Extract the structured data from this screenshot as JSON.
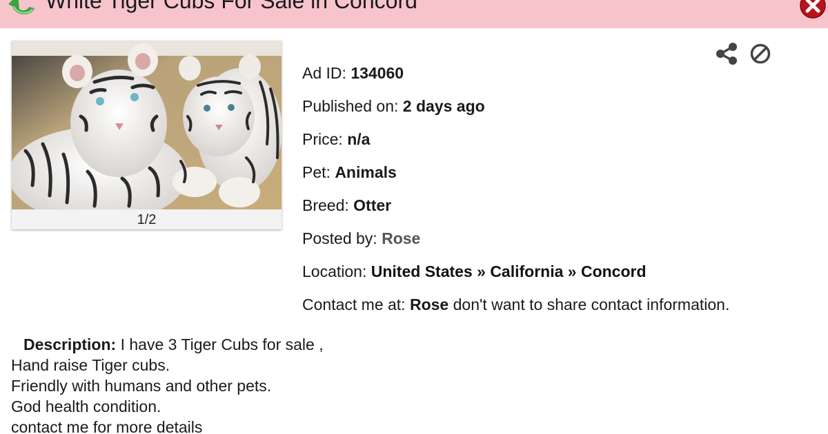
{
  "header": {
    "title": "White Tiger Cubs For Sale in Concord",
    "background_color": "#f8c4cc",
    "back_icon": "back-arrow-icon",
    "close_icon": "close-icon"
  },
  "gallery": {
    "counter": "1/2",
    "image_description_icon": "tiger-cubs-photo"
  },
  "actions": {
    "share_icon": "share-icon",
    "block_icon": "block-icon"
  },
  "details": {
    "ad_id_label": "Ad ID:",
    "ad_id_value": "134060",
    "published_label": "Published on:",
    "published_value": "2 days ago",
    "price_label": "Price:",
    "price_value": "n/a",
    "pet_label": "Pet:",
    "pet_value": "Animals",
    "breed_label": "Breed:",
    "breed_value": "Otter",
    "posted_by_label": "Posted by:",
    "posted_by_value": "Rose",
    "location_label": "Location:",
    "location_country": "United States",
    "location_state": "California",
    "location_city": "Concord",
    "location_separator": "»",
    "contact_label": "Contact me at:",
    "contact_name": "Rose",
    "contact_note": "don't want to share contact information."
  },
  "description": {
    "label": "Description:",
    "lines": [
      "I have 3 Tiger Cubs for sale ,",
      "Hand raise Tiger cubs.",
      "Friendly with humans and other pets.",
      "God health condition.",
      "contact me for more details"
    ]
  }
}
